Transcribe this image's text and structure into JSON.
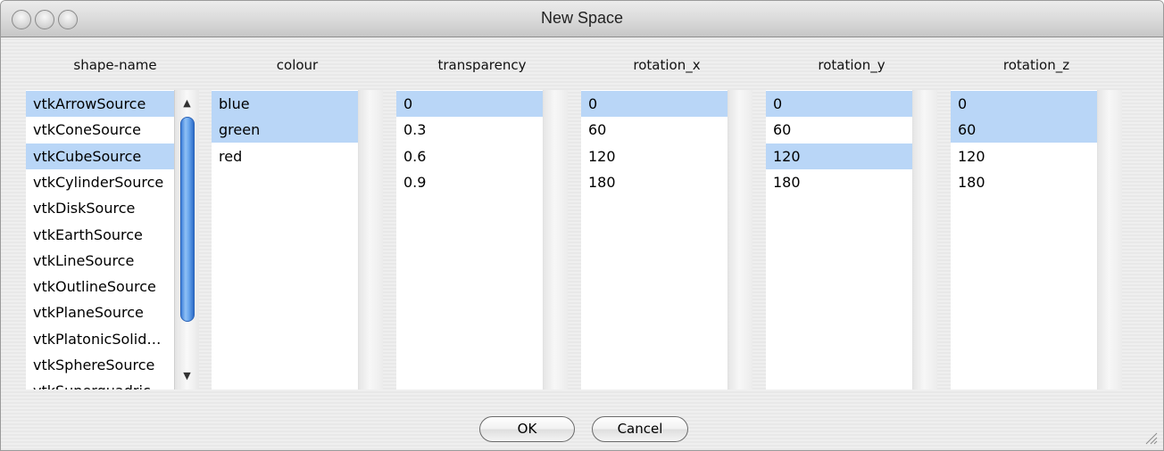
{
  "window": {
    "title": "New Space"
  },
  "columns": [
    {
      "header": "shape-name",
      "items": [
        "vtkArrowSource",
        "vtkConeSource",
        "vtkCubeSource",
        "vtkCylinderSource",
        "vtkDiskSource",
        "vtkEarthSource",
        "vtkLineSource",
        "vtkOutlineSource",
        "vtkPlaneSource",
        "vtkPlatonicSolid…",
        "vtkSphereSource",
        "vtkSuperquadric"
      ],
      "selected": [
        0,
        2
      ]
    },
    {
      "header": "colour",
      "items": [
        "blue",
        "green",
        "red"
      ],
      "selected": [
        0,
        1
      ]
    },
    {
      "header": "transparency",
      "items": [
        "0",
        "0.3",
        "0.6",
        "0.9"
      ],
      "selected": [
        0
      ]
    },
    {
      "header": "rotation_x",
      "items": [
        "0",
        "60",
        "120",
        "180"
      ],
      "selected": [
        0
      ]
    },
    {
      "header": "rotation_y",
      "items": [
        "0",
        "60",
        "120",
        "180"
      ],
      "selected": [
        0,
        2
      ]
    },
    {
      "header": "rotation_z",
      "items": [
        "0",
        "60",
        "120",
        "180"
      ],
      "selected": [
        0,
        1
      ]
    }
  ],
  "buttons": {
    "ok": "OK",
    "cancel": "Cancel"
  },
  "colors": {
    "selection": "#b9d6f7",
    "scroll_thumb": "#5b9be8"
  }
}
